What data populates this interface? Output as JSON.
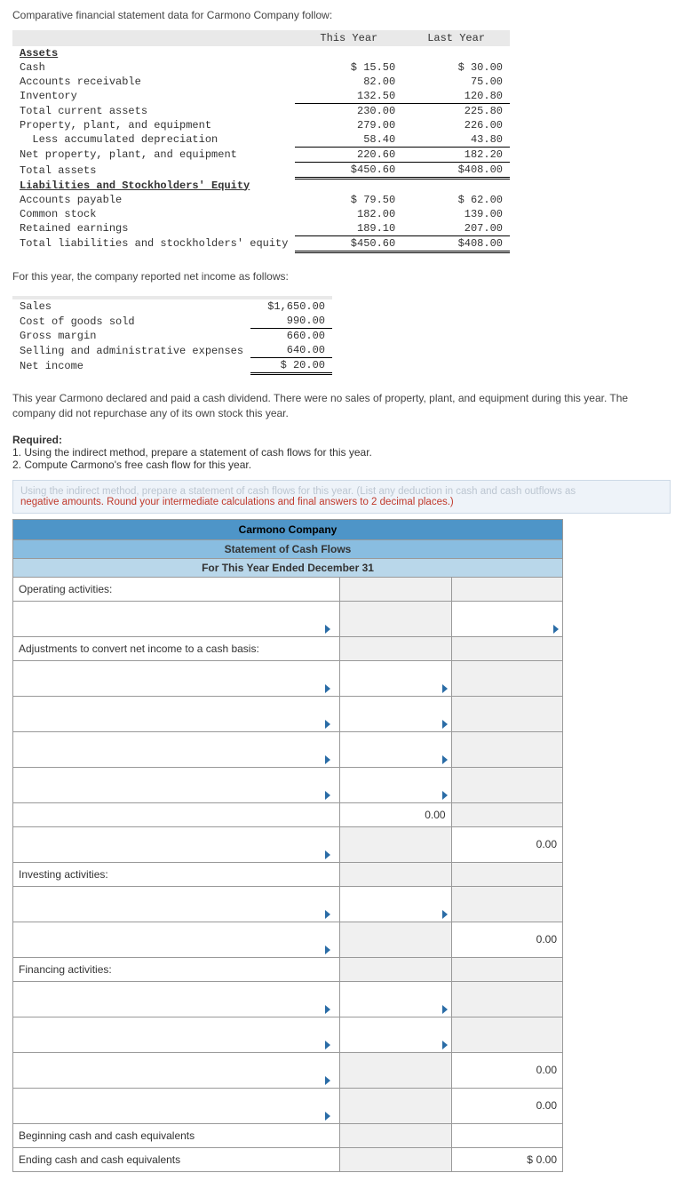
{
  "intro": "Comparative financial statement data for Carmono Company follow:",
  "bs": {
    "colThis": "This Year",
    "colLast": "Last Year",
    "assetsHdr": "Assets",
    "rows": [
      {
        "l": "Cash",
        "a": "$ 15.50",
        "b": "$ 30.00"
      },
      {
        "l": "Accounts receivable",
        "a": "82.00",
        "b": "75.00"
      },
      {
        "l": "Inventory",
        "a": "132.50",
        "b": "120.80",
        "u": true
      },
      {
        "l": "Total current assets",
        "a": "230.00",
        "b": "225.80"
      },
      {
        "l": "Property, plant, and equipment",
        "a": "279.00",
        "b": "226.00"
      },
      {
        "l": "  Less accumulated depreciation",
        "a": "58.40",
        "b": "43.80",
        "u": true
      },
      {
        "l": "Net property, plant, and equipment",
        "a": "220.60",
        "b": "182.20",
        "u": true
      },
      {
        "l": "Total assets",
        "a": "$450.60",
        "b": "$408.00",
        "uu": true
      }
    ],
    "liabHdr": "Liabilities and Stockholders' Equity",
    "rows2": [
      {
        "l": "Accounts payable",
        "a": "$ 79.50",
        "b": "$ 62.00"
      },
      {
        "l": "Common stock",
        "a": "182.00",
        "b": "139.00"
      },
      {
        "l": "Retained earnings",
        "a": "189.10",
        "b": "207.00",
        "u": true
      },
      {
        "l": "Total liabilities and stockholders' equity",
        "a": "$450.60",
        "b": "$408.00",
        "uu": true
      }
    ]
  },
  "incStmtIntro": "For this year, the company reported net income as follows:",
  "inc": [
    {
      "l": "Sales",
      "v": "$1,650.00"
    },
    {
      "l": "Cost of goods sold",
      "v": "990.00",
      "u": true
    },
    {
      "l": "Gross margin",
      "v": "660.00"
    },
    {
      "l": "Selling and administrative expenses",
      "v": "640.00",
      "u": true
    },
    {
      "l": "Net income",
      "v": "$   20.00",
      "uu": true
    }
  ],
  "para2": "This year Carmono declared and paid a cash dividend. There were no sales of property, plant, and equipment during this year. The company did not repurchase any of its own stock this year.",
  "required": {
    "h": "Required:",
    "r1": "1. Using the indirect method, prepare a statement of cash flows for this year.",
    "r2": "2. Compute Carmono's free cash flow for this year."
  },
  "hint": {
    "cut": "Using the indirect method, prepare a statement of cash flows for this year. (List any deduction in cash and cash outflows as",
    "red": "negative amounts. Round your intermediate calculations and final answers to 2 decimal places.)"
  },
  "cf": {
    "title": "Carmono Company",
    "sub": "Statement of Cash Flows",
    "period": "For This Year Ended December 31",
    "sections": {
      "op": "Operating activities:",
      "adj": "Adjustments to convert net income to a cash basis:",
      "inv": "Investing activities:",
      "fin": "Financing activities:",
      "beg": "Beginning cash and cash equivalents",
      "end": "Ending cash and cash equivalents"
    },
    "zero": "0.00",
    "dol": "$"
  },
  "chart_data": {
    "type": "table",
    "title": "Carmono Company comparative balance sheet and income statement",
    "balance_sheet": {
      "columns": [
        "This Year",
        "Last Year"
      ],
      "assets": {
        "Cash": [
          15.5,
          30.0
        ],
        "Accounts receivable": [
          82.0,
          75.0
        ],
        "Inventory": [
          132.5,
          120.8
        ],
        "Total current assets": [
          230.0,
          225.8
        ],
        "Property, plant, and equipment": [
          279.0,
          226.0
        ],
        "Less accumulated depreciation": [
          58.4,
          43.8
        ],
        "Net property, plant, and equipment": [
          220.6,
          182.2
        ],
        "Total assets": [
          450.6,
          408.0
        ]
      },
      "liabilities_and_equity": {
        "Accounts payable": [
          79.5,
          62.0
        ],
        "Common stock": [
          182.0,
          139.0
        ],
        "Retained earnings": [
          189.1,
          207.0
        ],
        "Total liabilities and stockholders' equity": [
          450.6,
          408.0
        ]
      }
    },
    "income_statement": {
      "Sales": 1650.0,
      "Cost of goods sold": 990.0,
      "Gross margin": 660.0,
      "Selling and administrative expenses": 640.0,
      "Net income": 20.0
    }
  }
}
